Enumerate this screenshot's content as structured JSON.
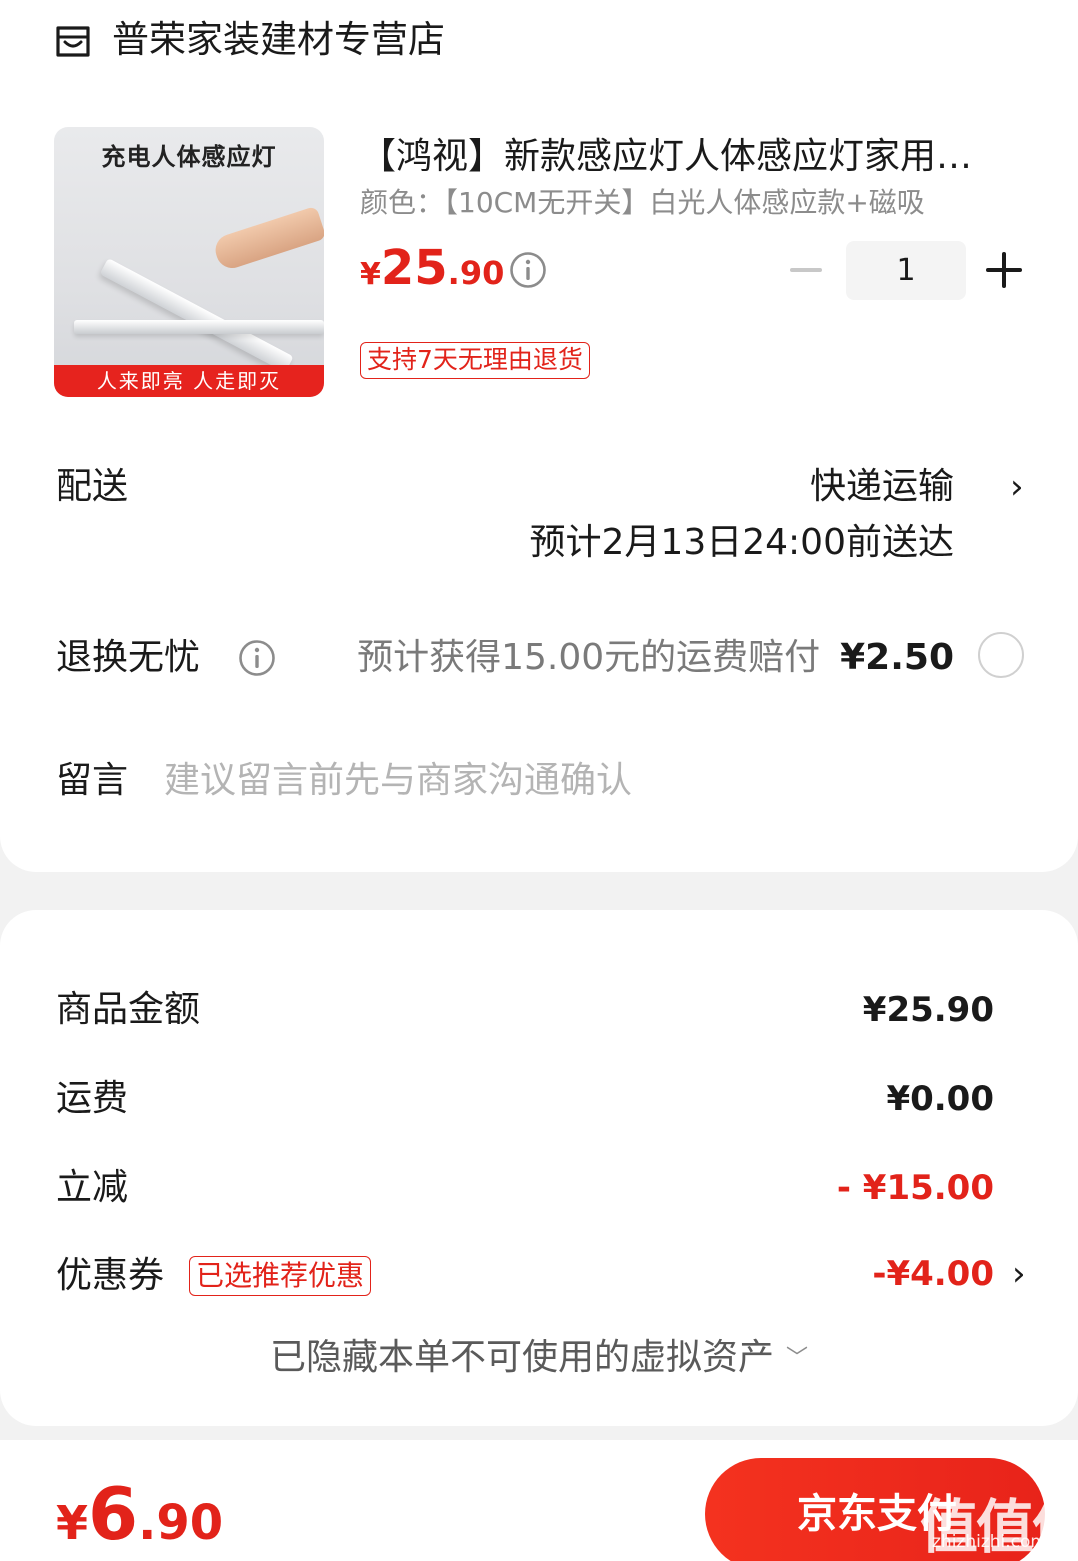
{
  "store": {
    "name": "普荣家装建材专营店",
    "icon": "store-icon"
  },
  "product": {
    "image": {
      "title": "充电人体感应灯",
      "banner": "人来即亮   人走即灭"
    },
    "title": "【鸿视】新款感应灯人体感应灯家用…",
    "spec": "颜色：【10CM无开关】白光人体感应款+磁吸",
    "price": {
      "currency": "¥",
      "integer": "25",
      "decimal": ".90"
    },
    "quantity": "1",
    "return_tag": "支持7天无理由退货"
  },
  "delivery": {
    "label": "配送",
    "method": "快递运输",
    "eta": "预计2月13日24:00前送达"
  },
  "return_insurance": {
    "label": "退换无忧",
    "text": "预计获得15.00元的运费赔付",
    "price": "¥2.50"
  },
  "message": {
    "label": "留言",
    "placeholder": "建议留言前先与商家沟通确认"
  },
  "summary": {
    "goods_label": "商品金额",
    "goods_value": "¥25.90",
    "shipping_label": "运费",
    "shipping_value": "¥0.00",
    "discount_label": "立减",
    "discount_value": "- ¥15.00",
    "coupon_label": "优惠券",
    "coupon_tag": "已选推荐优惠",
    "coupon_value": "-¥4.00",
    "hidden_assets": "已隐藏本单不可使用的虚拟资产"
  },
  "footer": {
    "total": {
      "currency": "¥",
      "integer": "6",
      "decimal": ".90"
    },
    "pay_label": "京东支付"
  },
  "watermark": {
    "main": "值值值",
    "sub": "zhizhizhi.com"
  },
  "colors": {
    "accent": "#e2231a",
    "muted": "#8c8c8c",
    "placeholder": "#b4b4b4"
  }
}
